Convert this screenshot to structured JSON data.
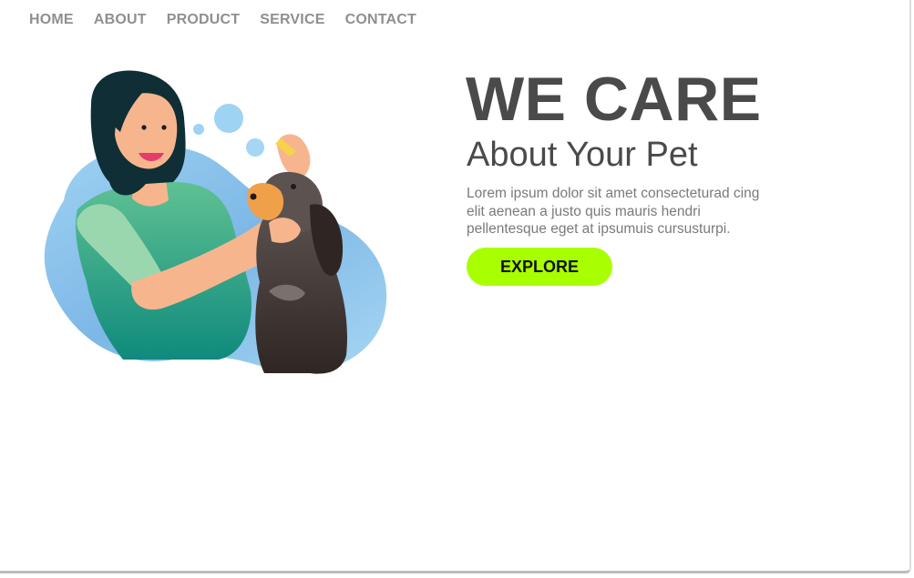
{
  "nav": {
    "items": [
      {
        "label": "HOME"
      },
      {
        "label": "ABOUT"
      },
      {
        "label": "PRODUCT"
      },
      {
        "label": "SERVICE"
      },
      {
        "label": "CONTACT"
      }
    ]
  },
  "hero": {
    "title": "WE CARE",
    "subtitle": "About Your Pet",
    "text": "Lorem ipsum dolor sit amet consecteturad cing elit aenean a justo quis mauris hendri pellentesque eget at ipsumuis cursusturpi.",
    "button_label": "EXPLORE"
  },
  "colors": {
    "heading": "#4a4a4a",
    "nav_text": "#8f8f8f",
    "body_text": "#7a7a7a",
    "button_bg": "#a8ff00",
    "blob_blue": "#8ec8ee",
    "shirt_green": "#3cae7f"
  }
}
